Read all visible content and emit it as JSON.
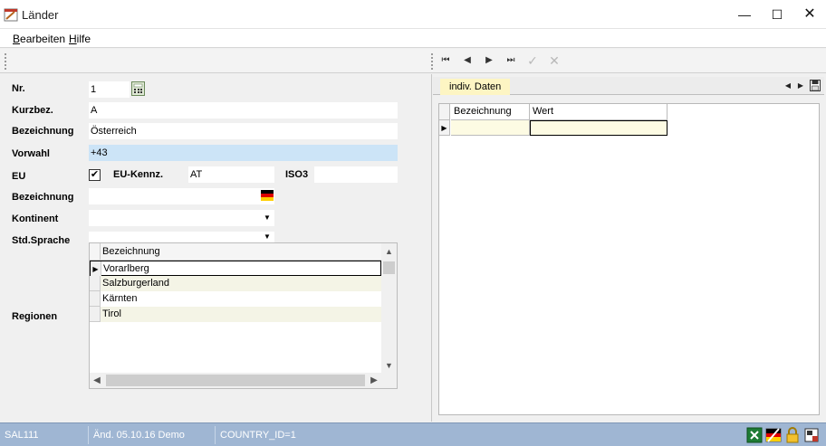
{
  "window": {
    "title": "Länder",
    "minimize_glyph": "—",
    "maximize_glyph": "☐",
    "close_glyph": "✕"
  },
  "menu": [
    {
      "mnemonic": "B",
      "rest": "earbeiten"
    },
    {
      "mnemonic": "H",
      "rest": "ilfe"
    }
  ],
  "nav": {
    "first": "⏮",
    "prev": "◀",
    "next": "▶",
    "last": "⏭",
    "confirm": "✓",
    "cancel": "✕"
  },
  "form": {
    "nr_label": "Nr.",
    "nr_value": "1",
    "kurzbez_label": "Kurzbez.",
    "kurzbez_value": "A",
    "bezeichnung_label": "Bezeichnung",
    "bezeichnung_value": "Österreich",
    "vorwahl_label": "Vorwahl",
    "vorwahl_value": "+43",
    "eu_label": "EU",
    "eu_checked": "✔",
    "eu_kennz_label": "EU-Kennz.",
    "eu_kennz_value": "AT",
    "iso3_label": "ISO3",
    "iso3_value": "",
    "bezeichnung2_label": "Bezeichnung",
    "bezeichnung2_value": "",
    "kontinent_label": "Kontinent",
    "kontinent_value": "",
    "stdsprache_label": "Std.Sprache",
    "stdsprache_value": "",
    "regionen_label": "Regionen"
  },
  "regions_grid": {
    "header": "Bezeichnung",
    "rows": [
      "Vorarlberg",
      "Salzburgerland",
      "Kärnten",
      "Tirol"
    ]
  },
  "right": {
    "tab_label": "indiv. Daten",
    "grid_headers": [
      "Bezeichnung",
      "Wert"
    ]
  },
  "status": {
    "code": "SAL111",
    "changed": "Änd. 05.10.16 Demo",
    "record": "COUNTRY_ID=1"
  },
  "colors": {
    "status_bg": "#9fb6d3",
    "highlight": "#cce4f7",
    "tab_bg": "#fdf5c3"
  }
}
